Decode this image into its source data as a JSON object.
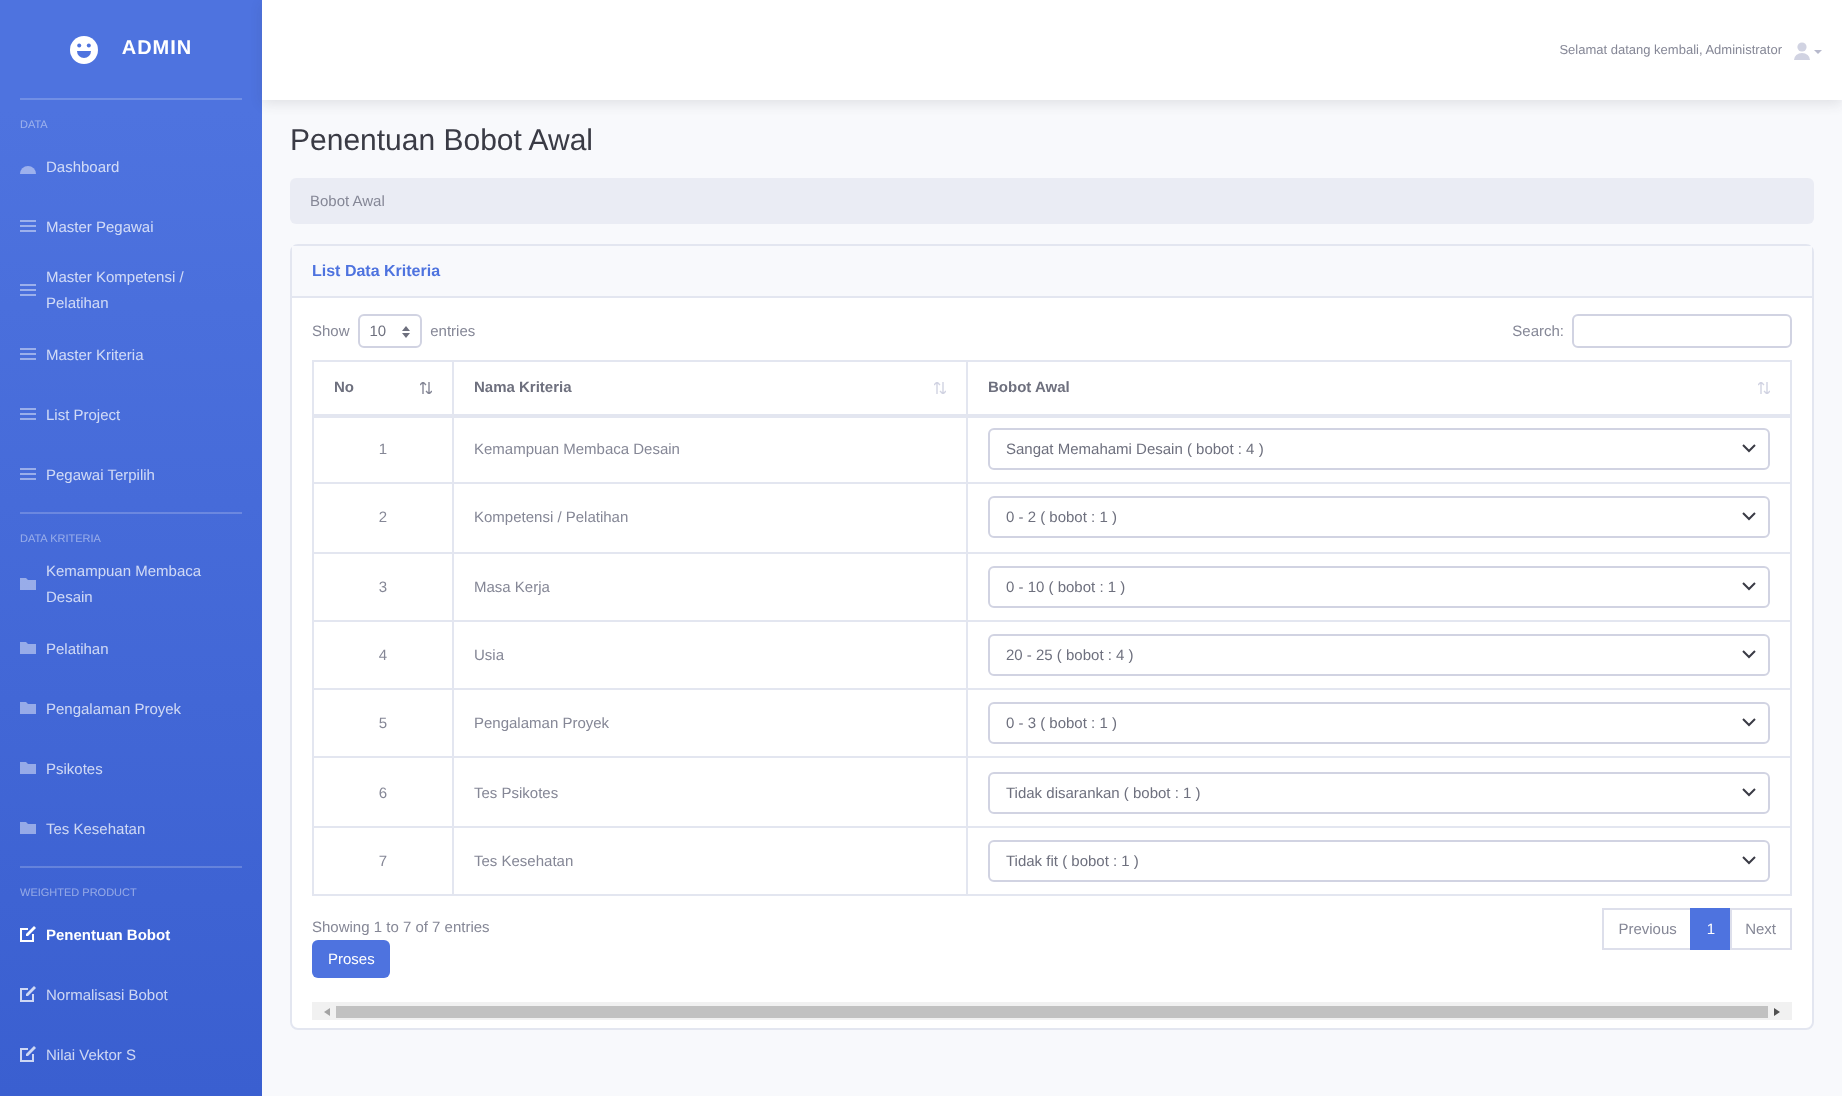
{
  "sidebar": {
    "brand": "ADMIN",
    "sections": [
      {
        "heading": "DATA",
        "items": [
          {
            "label": "Dashboard",
            "kind": "gauge",
            "selected": false
          },
          {
            "label": "Master Pegawai",
            "kind": "list",
            "selected": false
          },
          {
            "label": "Master Kompetensi / Pelatihan",
            "kind": "list",
            "selected": false
          },
          {
            "label": "Master Kriteria",
            "kind": "list",
            "selected": false
          },
          {
            "label": "List Project",
            "kind": "list",
            "selected": false
          },
          {
            "label": "Pegawai Terpilih",
            "kind": "list",
            "selected": false
          }
        ]
      },
      {
        "heading": "DATA KRITERIA",
        "items": [
          {
            "label": "Kemampuan Membaca Desain",
            "kind": "folder",
            "selected": false
          },
          {
            "label": "Pelatihan",
            "kind": "folder",
            "selected": false
          },
          {
            "label": "Pengalaman Proyek",
            "kind": "folder",
            "selected": false
          },
          {
            "label": "Psikotes",
            "kind": "folder",
            "selected": false
          },
          {
            "label": "Tes Kesehatan",
            "kind": "folder",
            "selected": false
          }
        ]
      },
      {
        "heading": "WEIGHTED PRODUCT",
        "items": [
          {
            "label": "Penentuan Bobot",
            "kind": "edit",
            "selected": true
          },
          {
            "label": "Normalisasi Bobot",
            "kind": "edit",
            "selected": false
          },
          {
            "label": "Nilai Vektor S",
            "kind": "edit",
            "selected": false
          }
        ]
      }
    ]
  },
  "topbar": {
    "greeting": "Selamat datang kembali, Administrator"
  },
  "page_title": "Penentuan Bobot Awal",
  "breadcrumb": "Bobot Awal",
  "card": {
    "title": "List Data Kriteria",
    "show_label": "Show",
    "page_size": "10",
    "entries_label": "entries",
    "search_label": "Search:",
    "columns": [
      {
        "label": "No",
        "sortable": true
      },
      {
        "label": "Nama Kriteria",
        "sortable": true
      },
      {
        "label": "Bobot Awal",
        "sortable": true
      }
    ],
    "rows": [
      {
        "no": "1",
        "name": "Kemampuan Membaca Desain",
        "bobot": "Sangat Memahami Desain ( bobot : 4 )"
      },
      {
        "no": "2",
        "name": "Kompetensi / Pelatihan",
        "bobot": "0 - 2 ( bobot : 1 )"
      },
      {
        "no": "3",
        "name": "Masa Kerja",
        "bobot": "0 - 10 ( bobot : 1 )"
      },
      {
        "no": "4",
        "name": "Usia",
        "bobot": "20 - 25 ( bobot : 4 )"
      },
      {
        "no": "5",
        "name": "Pengalaman Proyek",
        "bobot": "0 - 3 ( bobot : 1 )"
      },
      {
        "no": "6",
        "name": "Tes Psikotes",
        "bobot": "Tidak disarankan ( bobot : 1 )"
      },
      {
        "no": "7",
        "name": "Tes Kesehatan",
        "bobot": "Tidak fit ( bobot : 1 )"
      }
    ],
    "info": "Showing 1 to 7 of 7 entries",
    "pagination": [
      {
        "label": "Previous",
        "selected": false
      },
      {
        "label": "1",
        "selected": true
      },
      {
        "label": "Next",
        "selected": false
      }
    ],
    "button": "Proses"
  }
}
